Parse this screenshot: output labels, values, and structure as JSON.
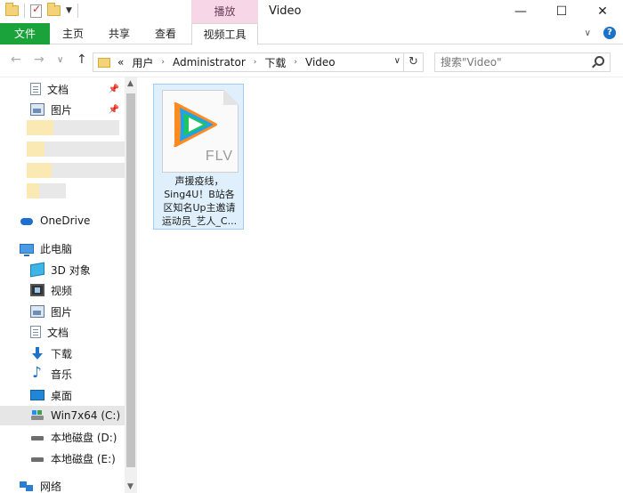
{
  "window": {
    "title": "Video",
    "context_tab": "播放",
    "minimize": "—",
    "maximize": "☐",
    "close": "✕"
  },
  "ribbon": {
    "tabs": [
      "文件",
      "主页",
      "共享",
      "查看",
      "视频工具"
    ],
    "help": "?",
    "expand": "∨"
  },
  "address": {
    "back": "←",
    "forward": "→",
    "recent": "∨",
    "up": "↑",
    "overflow": "«",
    "crumbs": [
      "用户",
      "Administrator",
      "下载",
      "Video"
    ],
    "refresh": "↻",
    "dropdown": "∨"
  },
  "search": {
    "placeholder": "搜索\"Video\""
  },
  "nav": {
    "quick": [
      {
        "label": "文档",
        "icon": "document-icon",
        "pinned": true
      },
      {
        "label": "图片",
        "icon": "pictures-icon",
        "pinned": true
      }
    ],
    "onedrive": "OneDrive",
    "this_pc": "此电脑",
    "pc_items": [
      {
        "label": "3D 对象",
        "icon": "3d-objects-icon"
      },
      {
        "label": "视频",
        "icon": "videos-icon"
      },
      {
        "label": "图片",
        "icon": "pictures-icon"
      },
      {
        "label": "文档",
        "icon": "document-icon"
      },
      {
        "label": "下载",
        "icon": "downloads-icon"
      },
      {
        "label": "音乐",
        "icon": "music-icon"
      },
      {
        "label": "桌面",
        "icon": "desktop-icon"
      },
      {
        "label": "Win7x64 (C:)",
        "icon": "drive-c-icon",
        "selected": true
      },
      {
        "label": "本地磁盘 (D:)",
        "icon": "drive-icon"
      },
      {
        "label": "本地磁盘 (E:)",
        "icon": "drive-icon"
      }
    ],
    "network": "网络"
  },
  "files": [
    {
      "name_lines": [
        "声援疫线，",
        "Sing4U！B站各",
        "区知名Up主邀请",
        "运动员_艺人_C..."
      ],
      "ext": "FLV",
      "icon": "tencent-video-icon",
      "selected": true
    }
  ],
  "colors": {
    "file_tab": "#19a33a",
    "context_tab": "#f7d7e7",
    "selection": "#dff0fc"
  }
}
